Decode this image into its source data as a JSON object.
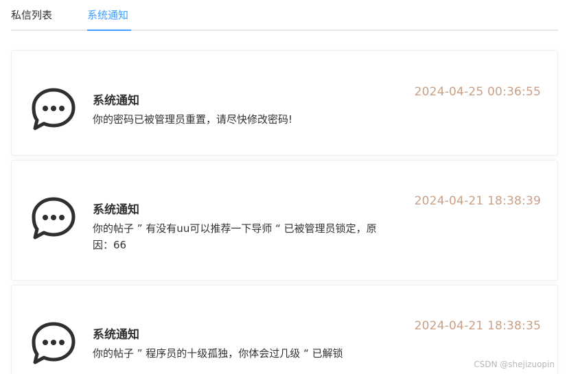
{
  "tabs": [
    {
      "label": "私信列表",
      "active": false
    },
    {
      "label": "系统通知",
      "active": true
    }
  ],
  "notifications": [
    {
      "title": "系统通知",
      "content": "你的密码已被管理员重置，请尽快修改密码!",
      "time": "2024-04-25 00:36:55",
      "icon": "chat-bubble-icon"
    },
    {
      "title": "系统通知",
      "content": "你的帖子 ” 有没有uu可以推荐一下导师 “ 已被管理员锁定，原因：66",
      "time": "2024-04-21 18:38:39",
      "icon": "chat-bubble-icon"
    },
    {
      "title": "系统通知",
      "content": "你的帖子 ” 程序员的十级孤独，你体会过几级 “ 已解锁",
      "time": "2024-04-21 18:38:35",
      "icon": "chat-bubble-icon"
    }
  ],
  "watermark": "CSDN @shejizuopin",
  "colors": {
    "accent": "#409eff",
    "time": "#c8a085",
    "text": "#303133"
  }
}
